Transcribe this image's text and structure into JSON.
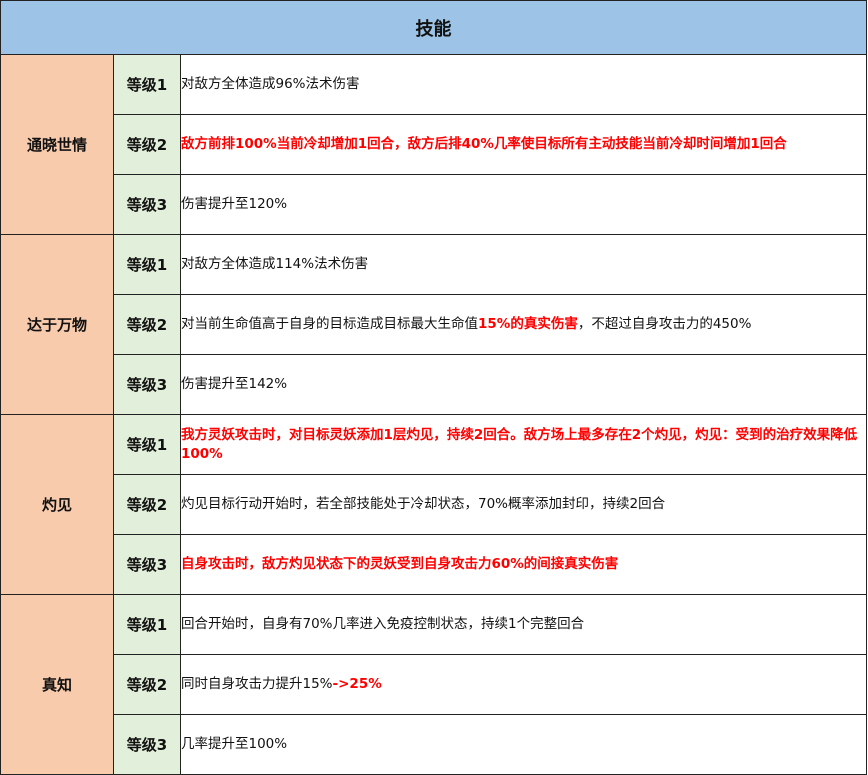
{
  "title": "技能",
  "skills": [
    {
      "name": "通晓世情",
      "levels": [
        {
          "label": "等级1",
          "parts": [
            {
              "text": "对敌方全体造成96%法术伤害",
              "red": false
            }
          ]
        },
        {
          "label": "等级2",
          "parts": [
            {
              "text": "敌方前排100%当前冷却增加1回合，敌方后排40%几率使目标所有主动技能当前冷却时间增加1回合",
              "red": true
            }
          ]
        },
        {
          "label": "等级3",
          "parts": [
            {
              "text": "伤害提升至120%",
              "red": false
            }
          ]
        }
      ]
    },
    {
      "name": "达于万物",
      "levels": [
        {
          "label": "等级1",
          "parts": [
            {
              "text": "对敌方全体造成114%法术伤害",
              "red": false
            }
          ]
        },
        {
          "label": "等级2",
          "parts": [
            {
              "text": "对当前生命值高于自身的目标造成目标最大生命值",
              "red": false
            },
            {
              "text": "15%的真实伤害",
              "red": true
            },
            {
              "text": "，不超过自身攻击力的450%",
              "red": false
            }
          ]
        },
        {
          "label": "等级3",
          "parts": [
            {
              "text": "伤害提升至142%",
              "red": false
            }
          ]
        }
      ]
    },
    {
      "name": "灼见",
      "levels": [
        {
          "label": "等级1",
          "parts": [
            {
              "text": "我方灵妖攻击时，对目标灵妖添加1层灼见，持续2回合。敌方场上最多存在2个灼见，灼见：受到的治疗效果降低100%",
              "red": true
            }
          ]
        },
        {
          "label": "等级2",
          "parts": [
            {
              "text": "灼见目标行动开始时，若全部技能处于冷却状态，70%概率添加封印，持续2回合",
              "red": false
            }
          ]
        },
        {
          "label": "等级3",
          "parts": [
            {
              "text": "自身攻击时，敌方灼见状态下的灵妖受到自身攻击力60%的间接真实伤害",
              "red": true
            }
          ]
        }
      ]
    },
    {
      "name": "真知",
      "levels": [
        {
          "label": "等级1",
          "parts": [
            {
              "text": "回合开始时，自身有70%几率进入免疫控制状态，持续1个完整回合",
              "red": false
            }
          ]
        },
        {
          "label": "等级2",
          "parts": [
            {
              "text": "同时自身攻击力提升15%",
              "red": false
            },
            {
              "text": "->25%",
              "red": true
            }
          ]
        },
        {
          "label": "等级3",
          "parts": [
            {
              "text": "几率提升至100%",
              "red": false
            }
          ]
        }
      ]
    }
  ]
}
